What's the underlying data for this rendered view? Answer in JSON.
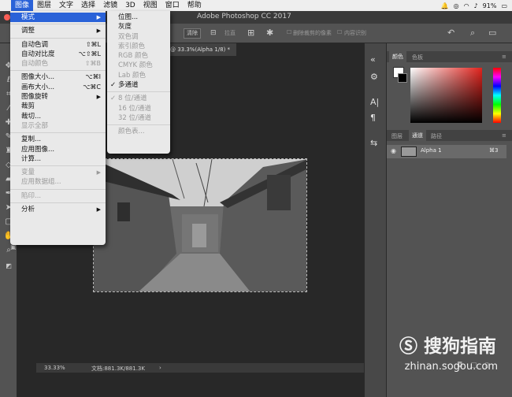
{
  "menubar": {
    "apple": "",
    "items": [
      "图像",
      "图层",
      "文字",
      "选择",
      "滤镜",
      "3D",
      "视图",
      "窗口",
      "帮助"
    ],
    "battery": "91%"
  },
  "title": "Adobe Photoshop CC 2017",
  "options": {
    "clear_label": "清除",
    "straighten_label": "拉直",
    "delete_cropped_label": "删除裁剪的像素",
    "content_aware_label": "内容识别"
  },
  "doc_tab": "@ 33.3%(Alpha 1/8) *",
  "status": {
    "zoom": "33.33%",
    "doc": "文档:881.3K/881.3K"
  },
  "image_menu": [
    {
      "label": "模式",
      "submenu": true,
      "highlight": true
    },
    {
      "sep": true
    },
    {
      "label": "调整",
      "submenu": true
    },
    {
      "sep": true
    },
    {
      "label": "自动色调",
      "shortcut": "⇧⌘L"
    },
    {
      "label": "自动对比度",
      "shortcut": "⌥⇧⌘L"
    },
    {
      "label": "自动颜色",
      "shortcut": "⇧⌘B",
      "disabled": true
    },
    {
      "sep": true
    },
    {
      "label": "图像大小...",
      "shortcut": "⌥⌘I"
    },
    {
      "label": "画布大小...",
      "shortcut": "⌥⌘C"
    },
    {
      "label": "图像旋转",
      "submenu": true
    },
    {
      "label": "裁剪"
    },
    {
      "label": "裁切..."
    },
    {
      "label": "显示全部",
      "disabled": true
    },
    {
      "sep": true
    },
    {
      "label": "复制..."
    },
    {
      "label": "应用图像..."
    },
    {
      "label": "计算..."
    },
    {
      "sep": true
    },
    {
      "label": "变量",
      "submenu": true,
      "disabled": true
    },
    {
      "label": "应用数据组...",
      "disabled": true
    },
    {
      "sep": true
    },
    {
      "label": "陷印...",
      "disabled": true
    },
    {
      "sep": true
    },
    {
      "label": "分析",
      "submenu": true
    }
  ],
  "mode_menu": [
    {
      "label": "位图..."
    },
    {
      "label": "灰度"
    },
    {
      "label": "双色调",
      "disabled": true
    },
    {
      "label": "索引颜色",
      "disabled": true
    },
    {
      "label": "RGB 颜色",
      "disabled": true
    },
    {
      "label": "CMYK 颜色",
      "disabled": true
    },
    {
      "label": "Lab 颜色",
      "disabled": true
    },
    {
      "label": "多通道",
      "checked": true
    },
    {
      "sep": true
    },
    {
      "label": "8 位/通道",
      "checked": true,
      "disabled": true
    },
    {
      "label": "16 位/通道",
      "disabled": true
    },
    {
      "label": "32 位/通道",
      "disabled": true
    },
    {
      "sep": true
    },
    {
      "label": "颜色表...",
      "disabled": true
    }
  ],
  "color_panel": {
    "tabs": [
      "颜色",
      "色板"
    ]
  },
  "channels_panel": {
    "tabs": [
      "图层",
      "通道",
      "路径"
    ],
    "rows": [
      {
        "name": "Alpha 1",
        "shortcut": "⌘3"
      }
    ]
  },
  "watermark": {
    "brand": "搜狗指南",
    "url": "zhinan.sogou.com"
  }
}
